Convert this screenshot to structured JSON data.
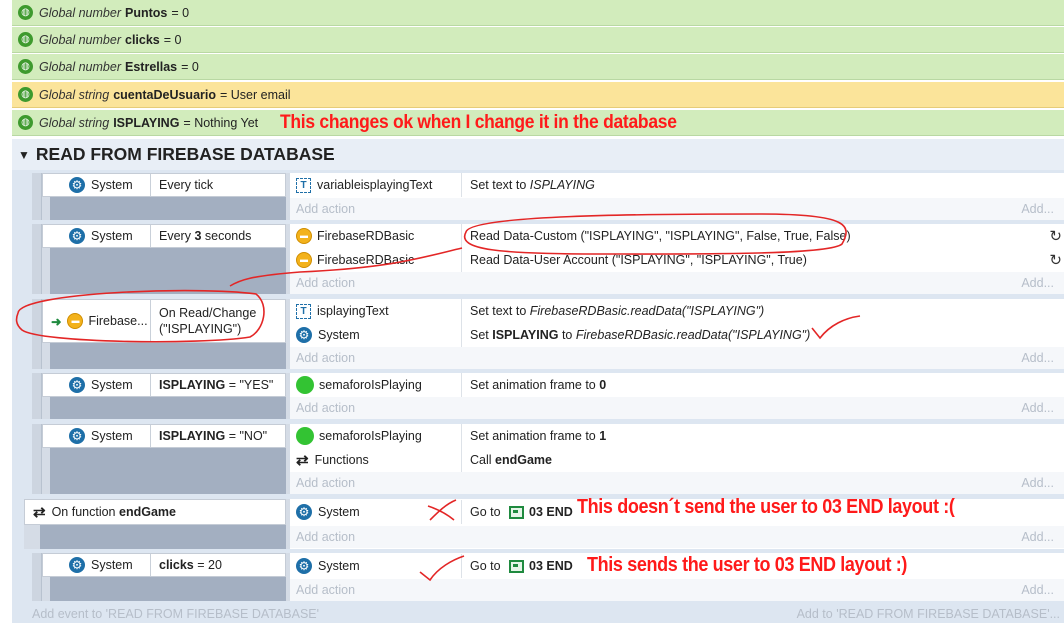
{
  "globals": [
    {
      "kind": "Global number",
      "name": "Puntos",
      "value": "= 0",
      "note": ""
    },
    {
      "kind": "Global number",
      "name": "clicks",
      "value": "= 0",
      "note": ""
    },
    {
      "kind": "Global number",
      "name": "Estrellas",
      "value": "= 0",
      "note": ""
    },
    {
      "kind": "Global string",
      "name": "cuentaDeUsuario",
      "value": "= User email",
      "note": ""
    },
    {
      "kind": "Global string",
      "name": "ISPLAYING",
      "value": "= Nothing Yet",
      "note": "This changes ok when I change it in the database"
    }
  ],
  "group": {
    "title": "READ FROM FIREBASE DATABASE",
    "arrow": "▼"
  },
  "add_action": "Add action",
  "add_right": "Add...",
  "events": [
    {
      "cond_obj": "System",
      "cond_pre": "Every tick",
      "cond_bold": "",
      "cond_post": "",
      "actions": [
        {
          "obj": "variableisplayingText",
          "pre": "Set text to ",
          "bold": "",
          "ital": "ISPLAYING",
          "post": ""
        }
      ]
    },
    {
      "cond_obj": "System",
      "cond_pre": "Every ",
      "cond_bold": "3",
      "cond_post": " seconds",
      "actions": [
        {
          "obj": "FirebaseRDBasic",
          "pre": "Read Data-Custom (\"ISPLAYING\", \"ISPLAYING\", False, True, False)",
          "bold": "",
          "ital": "",
          "post": ""
        },
        {
          "obj": "FirebaseRDBasic",
          "pre": "Read Data-User Account (\"ISPLAYING\", \"ISPLAYING\", True)",
          "bold": "",
          "ital": "",
          "post": ""
        }
      ]
    },
    {
      "cond_obj": "Firebase...",
      "cond_pre": "On Read/Change (\"ISPLAYING\")",
      "cond_bold": "",
      "cond_post": "",
      "actions": [
        {
          "obj": "isplayingText",
          "pre": "Set text to ",
          "bold": "",
          "ital": "FirebaseRDBasic.readData(\"ISPLAYING\")",
          "post": ""
        },
        {
          "obj": "System",
          "pre": "Set ",
          "bold": "ISPLAYING",
          "ital": "FirebaseRDBasic.readData(\"ISPLAYING\")",
          "post": " to "
        }
      ]
    },
    {
      "cond_obj": "System",
      "cond_pre": "",
      "cond_bold": "ISPLAYING",
      "cond_post": " = \"YES\"",
      "actions": [
        {
          "obj": "semaforoIsPlaying",
          "pre": "Set animation frame to ",
          "bold": "0",
          "ital": "",
          "post": ""
        }
      ]
    },
    {
      "cond_obj": "System",
      "cond_pre": "",
      "cond_bold": "ISPLAYING",
      "cond_post": " = \"NO\"",
      "actions": [
        {
          "obj": "semaforoIsPlaying",
          "pre": "Set animation frame to ",
          "bold": "1",
          "ital": "",
          "post": ""
        },
        {
          "obj": "Functions",
          "pre": "Call ",
          "bold": "endGame",
          "ital": "",
          "post": ""
        }
      ]
    },
    {
      "cond_obj": "On function",
      "cond_pre": "",
      "cond_bold": "endGame",
      "cond_post": "",
      "actions": [
        {
          "obj": "System",
          "pre": "Go to ",
          "bold": "03 END",
          "ital": "",
          "post": ""
        }
      ],
      "note": "This doesn´t send the user to 03 END layout :("
    },
    {
      "cond_obj": "System",
      "cond_pre": "",
      "cond_bold": "clicks",
      "cond_post": " = 20",
      "actions": [
        {
          "obj": "System",
          "pre": "Go to ",
          "bold": "03 END",
          "ital": "",
          "post": ""
        }
      ],
      "note": "This sends the user to 03 END layout :)"
    }
  ],
  "add_event_left": "Add event to 'READ FROM FIREBASE DATABASE'",
  "add_event_right": "Add to 'READ FROM FIREBASE DATABASE'..."
}
